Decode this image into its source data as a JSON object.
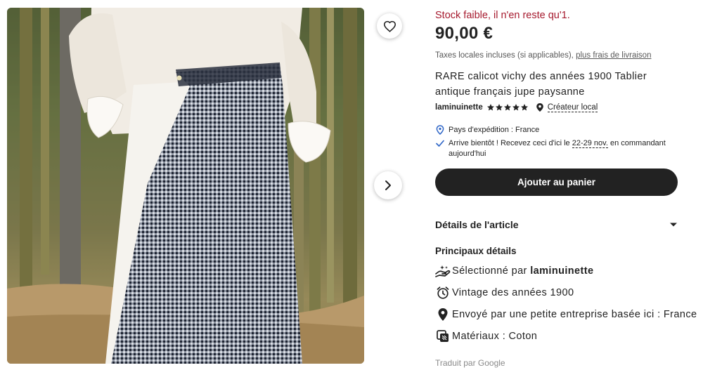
{
  "listing_photo": {
    "alt": ""
  },
  "favorite": {
    "icon": "heart-icon"
  },
  "carousel": {
    "next_icon": "chevron-right-icon"
  },
  "stock_notice": "Stock faible, il n'en reste qu'1.",
  "price": "90,00 €",
  "taxes": {
    "text": "Taxes locales incluses (si applicables),",
    "link": "plus frais de livraison"
  },
  "title": "RARE calicot vichy des années 1900 Tablier antique français jupe paysanne",
  "seller": {
    "name": "laminuinette",
    "rating": 5,
    "creator_label": "Créateur local"
  },
  "shipping": {
    "origin": "Pays d'expédition : France",
    "arrive_prefix": "Arrive bientôt ! Recevez ceci d'ici le",
    "arrive_dates": "22-29 nov.",
    "arrive_suffix": "en commandant aujourd'hui"
  },
  "cart_button": "Ajouter au panier",
  "details": {
    "header": "Détails de l'article",
    "main_title": "Principaux détails",
    "items": [
      {
        "icon": "hand-selected-icon",
        "text": "Sélectionné par",
        "bold": "laminuinette"
      },
      {
        "icon": "vintage-clock-icon",
        "text": "Vintage des années 1900",
        "bold": ""
      },
      {
        "icon": "location-pin-icon",
        "text": "Envoyé par une petite entreprise basée ici : France",
        "bold": ""
      },
      {
        "icon": "materials-icon",
        "text": "Matériaux : Coton",
        "bold": ""
      }
    ],
    "translated_by": "Traduit par Google"
  },
  "colors": {
    "stock_red": "#a61a2e",
    "button_dark": "#222222",
    "check_blue": "#2f66c7",
    "muted": "#595959"
  }
}
